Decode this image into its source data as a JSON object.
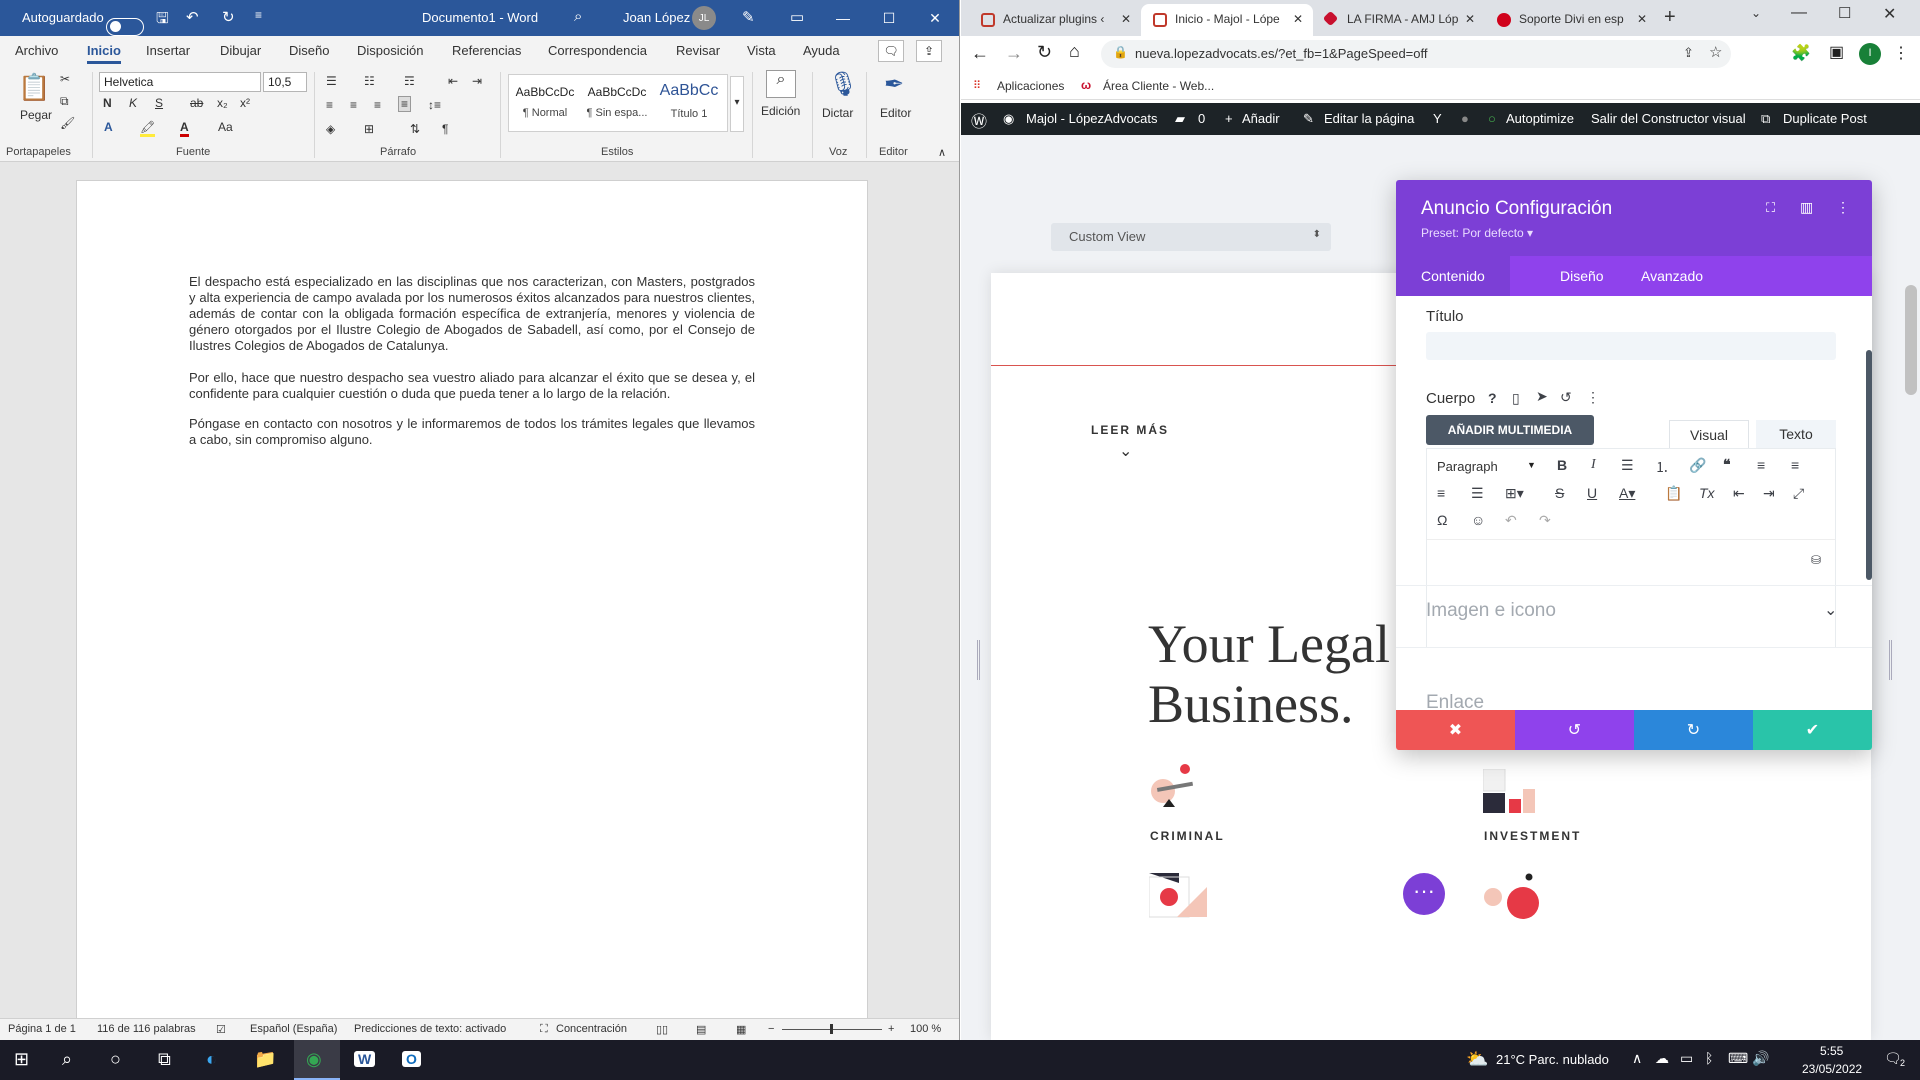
{
  "word": {
    "autosave_label": "Autoguardado",
    "doc_title": "Documento1 - Word",
    "user_name": "Joan López",
    "user_initials": "JL",
    "tabs": [
      "Archivo",
      "Inicio",
      "Insertar",
      "Dibujar",
      "Diseño",
      "Disposición",
      "Referencias",
      "Correspondencia",
      "Revisar",
      "Vista",
      "Ayuda"
    ],
    "active_tab": "Inicio",
    "ribbon": {
      "paste_label": "Pegar",
      "font_name": "Helvetica",
      "font_size": "10,5",
      "styles": [
        {
          "sample": "AaBbCcDc",
          "name": "¶ Normal"
        },
        {
          "sample": "AaBbCcDc",
          "name": "¶ Sin espa..."
        },
        {
          "sample": "AaBbCc",
          "name": "Título 1"
        }
      ],
      "edicion_label": "Edición",
      "dictar_label": "Dictar",
      "editor_label": "Editor",
      "groups": [
        "Portapapeles",
        "Fuente",
        "Párrafo",
        "Estilos",
        "Voz",
        "Editor"
      ]
    },
    "paragraphs": [
      "El despacho está especializado en las disciplinas que nos caracterizan, con Masters, postgrados y alta experiencia de campo avalada por los numerosos éxitos alcanzados para nuestros clientes, además de contar con la obligada formación específica de extranjería, menores y violencia de género otorgados por el Ilustre Colegio de Abogados de Sabadell, así como, por el Consejo de Ilustres Colegios de Abogados de Catalunya.",
      "Por ello, hace que nuestro despacho sea vuestro aliado para alcanzar el éxito que se desea y, el confidente para cualquier cuestión o duda que pueda tener a lo largo de la relación.",
      "Póngase en contacto con nosotros y le informaremos de todos los trámites legales que llevamos a cabo, sin compromiso alguno."
    ],
    "status": {
      "page": "Página 1 de 1",
      "words": "116 de 116 palabras",
      "language": "Español (España)",
      "predictions": "Predicciones de texto: activado",
      "focus": "Concentración",
      "zoom": "100 %"
    }
  },
  "chrome": {
    "tabs": [
      {
        "title": "Actualizar plugins ‹",
        "color": "#c0392b"
      },
      {
        "title": "Inicio - Majol - Lópe",
        "color": "#c0392b"
      },
      {
        "title": "LA FIRMA - AMJ Lóp",
        "color": "#c8102e"
      },
      {
        "title": "Soporte Divi en esp",
        "color": "#d0021b"
      }
    ],
    "url": "nueva.lopezadvocats.es/?et_fb=1&PageSpeed=off",
    "bookmarks": [
      "Aplicaciones",
      "Área Cliente - Web..."
    ],
    "profile_initial": "I",
    "admin_bar": {
      "site": "Majol - LópezAdvocats",
      "comments": "0",
      "add": "Añadir",
      "edit": "Editar la página",
      "autoptimize": "Autoptimize",
      "exit": "Salir del Constructor visual",
      "duplicate": "Duplicate Post"
    },
    "site": {
      "view_select": "Custom View",
      "leer_mas": "LEER MÁS",
      "heading_line1": "Your Legal",
      "heading_line2": "Business.",
      "items": [
        "CRIMINAL",
        "INVESTMENT"
      ]
    },
    "modal": {
      "title": "Anuncio Configuración",
      "preset": "Preset: Por defecto ▾",
      "tabs": [
        "Contenido",
        "Diseño",
        "Avanzado"
      ],
      "titulo_label": "Título",
      "cuerpo_label": "Cuerpo",
      "add_media": "AÑADIR MULTIMEDIA",
      "visual_tab": "Visual",
      "texto_tab": "Texto",
      "paragraph_select": "Paragraph",
      "section_imagen": "Imagen e icono",
      "section_enlace": "Enlace"
    }
  },
  "taskbar": {
    "weather": "21°C  Parc. nublado",
    "time": "5:55",
    "date": "23/05/2022",
    "notifications": "2"
  }
}
